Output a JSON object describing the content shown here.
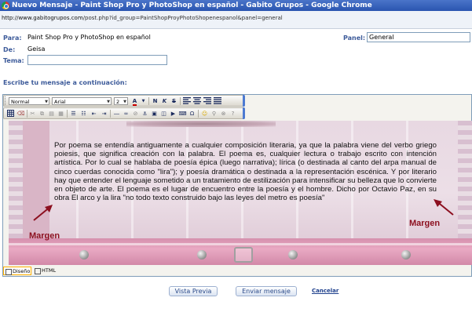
{
  "window": {
    "title": "Nuevo Mensaje - Paint Shop Pro y PhotoShop en español - Gabito Grupos - Google Chrome",
    "url_host": "http://www.gabitogrupos.com",
    "url_path": "/post.php?id_group=PaintShopProyPhotoShopenespanol&panel=general"
  },
  "form": {
    "para_label": "Para:",
    "para_value": "Paint Shop Pro y PhotoShop en español",
    "de_label": "De:",
    "de_value": "Geisa",
    "tema_label": "Tema:",
    "tema_value": "",
    "panel_label": "Panel:",
    "panel_value": "General",
    "message_label": "Escribe tu mensaje a continuación:"
  },
  "toolbar": {
    "style_value": "Normal",
    "font_value": "Arial",
    "size_value": "2",
    "bold": "N",
    "italic": "K",
    "strike": "S"
  },
  "editor": {
    "paragraph": "Por poema se entendía antiguamente a cualquier composición literaria, ya que la palabra viene del verbo griego poiesis, que significa creación con la palabra. El poema es, cualquier lectura o trabajo escrito con intención artística. Por lo cual se hablaba de poesía épica (luego narrativa); lírica (o destinada al canto del arpa manual de cinco cuerdas conocida como \"lira\"); y poesía dramática o destinada a la representación escénica. Y por literario hay que entender el lenguaje sometido a un tratamiento de estilización para intensificar su belleza que lo convierte en objeto de arte. El poema es el lugar de encuentro entre la poesía y el hombre. Dicho por Octavio Paz, en su obra El arco y la lira \"no todo texto construido bajo las leyes del metro es poesía\"",
    "annotation_left": "Margen",
    "annotation_right": "Margen",
    "mode_design": "Diseño",
    "mode_html": "HTML"
  },
  "actions": {
    "preview": "Vista Previa",
    "send": "Enviar mensaje",
    "cancel": "Cancelar"
  },
  "colors": {
    "label_blue": "#3d5b9a",
    "annotation_red": "#8c0f1f",
    "ribbon_pink": "#e9a9c3"
  }
}
